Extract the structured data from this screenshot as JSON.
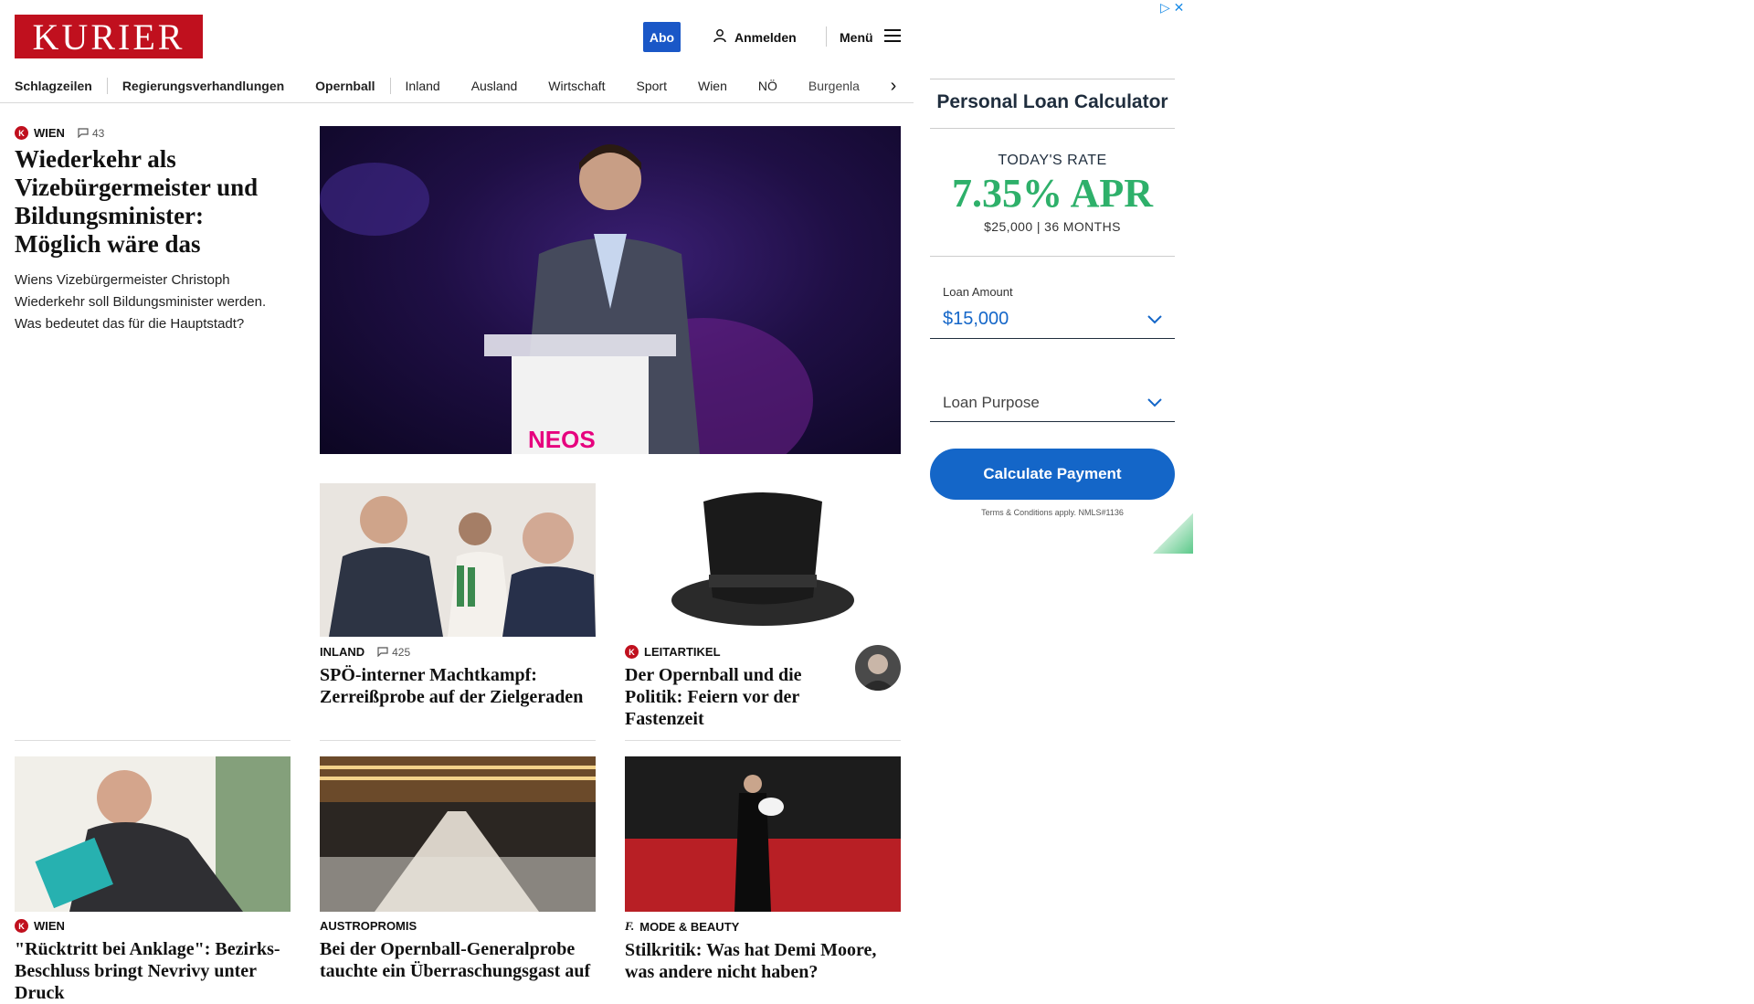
{
  "header": {
    "logo": "KURIER",
    "abo": "Abo",
    "login": "Anmelden",
    "menu": "Menü"
  },
  "nav": {
    "items": [
      "Schlagzeilen",
      "Regierungsverhandlungen",
      "Opernball",
      "Inland",
      "Ausland",
      "Wirtschaft",
      "Sport",
      "Wien",
      "NÖ",
      "Burgenla"
    ]
  },
  "lead_story": {
    "kicker": "WIEN",
    "comments": "43",
    "headline": "Wiederkehr als Vizebürgermeister und Bildungsminister: Möglich wäre das",
    "teaser": "Wiens Vizebürgermeister Christoph Wiederkehr soll Bildungsminister werden. Was bedeutet das für die Hauptstadt?",
    "image_caption": "NEOS"
  },
  "stories": [
    {
      "kicker": "INLAND",
      "comments": "425",
      "headline": "SPÖ-interner Machtkampf: Zerreißprobe auf der Zielgeraden"
    },
    {
      "kicker": "LEITARTIKEL",
      "headline": "Der Opernball und die Politik: Feiern vor der Fastenzeit"
    },
    {
      "kicker": "WIEN",
      "headline": "\"Rücktritt bei Anklage\": Bezirks-Beschluss bringt Nevrivy unter Druck"
    },
    {
      "kicker": "AUSTROPROMIS",
      "headline": "Bei der Opernball-Generalprobe tauchte ein Überraschungsgast auf"
    },
    {
      "kicker": "MODE & BEAUTY",
      "headline": "Stilkritik: Was hat Demi Moore, was andere nicht haben?"
    }
  ],
  "ad": {
    "title": "Personal Loan Calculator",
    "today_label": "TODAY'S RATE",
    "rate": "7.35% APR",
    "terms": "$25,000 | 36 MONTHS",
    "loan_amount_label": "Loan Amount",
    "loan_amount_value": "$15,000",
    "loan_purpose_placeholder": "Loan Purpose",
    "button": "Calculate Payment",
    "fineprint": "Terms & Conditions apply. NMLS#1136",
    "rate_color": "#2eb06a",
    "button_color": "#1466c8"
  },
  "icons": {
    "user": "user-icon",
    "menu": "hamburger-icon",
    "comment": "comment-icon",
    "chevron": "chevron-down-icon",
    "nav_next": "chevron-right-icon"
  }
}
